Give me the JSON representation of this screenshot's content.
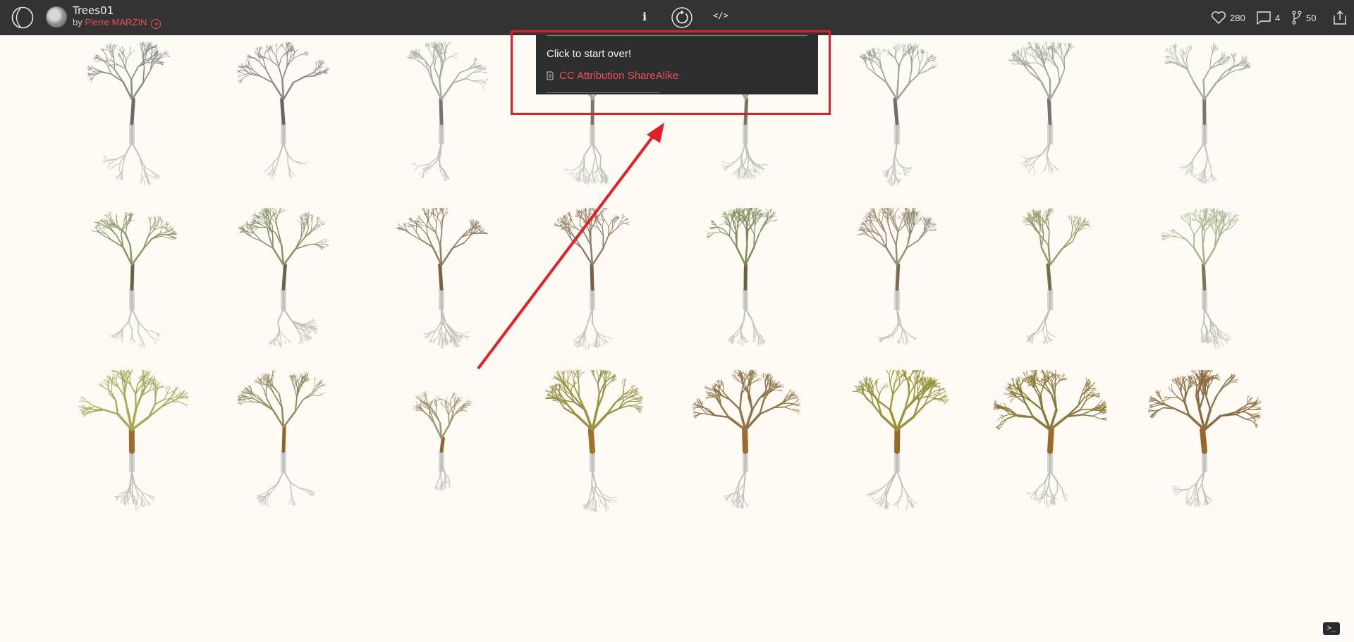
{
  "header": {
    "title": "Trees01",
    "by_prefix": "by",
    "author": "Pierre MARZIN",
    "follow_glyph": "+",
    "info_glyph": "i",
    "code_glyph": "</>",
    "stats": {
      "likes": "280",
      "comments": "4",
      "forks": "50"
    }
  },
  "popup": {
    "message": "Click to start over!",
    "license": "CC Attribution ShareAlike"
  },
  "console_glyph": "≻_",
  "colors": {
    "topbar": "#333333",
    "accent": "#e8535b",
    "canvas_bg": "#fdfbf4",
    "annotation": "#e0202a"
  },
  "icons": [
    "logo-icon",
    "avatar",
    "info-icon",
    "restart-icon",
    "code-icon",
    "heart-icon",
    "comment-icon",
    "fork-icon",
    "share-icon",
    "document-icon",
    "console-icon"
  ],
  "trees": [
    {
      "canopy": "#8a8a86",
      "trunk": "#6e6a63",
      "style": "bare"
    },
    {
      "canopy": "#8a8780",
      "trunk": "#6a655d",
      "style": "bare"
    },
    {
      "canopy": "#a8aca0",
      "trunk": "#77756d",
      "style": "bare"
    },
    {
      "canopy": "#a7a89a",
      "trunk": "#7a766a",
      "style": "bare"
    },
    {
      "canopy": "#a8a593",
      "trunk": "#7b7465",
      "style": "bare"
    },
    {
      "canopy": "#9ca099",
      "trunk": "#6f6d66",
      "style": "bare"
    },
    {
      "canopy": "#a3a69b",
      "trunk": "#75736a",
      "style": "bare"
    },
    {
      "canopy": "#a6ab9c",
      "trunk": "#7a786e",
      "style": "low"
    },
    {
      "canopy": "#8b9467",
      "trunk": "#6b6149",
      "style": "leafy"
    },
    {
      "canopy": "#8a906c",
      "trunk": "#6d634c",
      "style": "leafy"
    },
    {
      "canopy": "#8d7c60",
      "trunk": "#7a6245",
      "style": "leafy"
    },
    {
      "canopy": "#8f7c66",
      "trunk": "#76604a",
      "style": "low"
    },
    {
      "canopy": "#7e8a5a",
      "trunk": "#6c5f42",
      "style": "leafy"
    },
    {
      "canopy": "#978c72",
      "trunk": "#7e6a4c",
      "style": "leafy"
    },
    {
      "canopy": "#98996f",
      "trunk": "#786c4c",
      "style": "leafy"
    },
    {
      "canopy": "#a7b28f",
      "trunk": "#7e7456",
      "style": "leafy"
    },
    {
      "canopy": "#a6ab5c",
      "trunk": "#9a6b2a",
      "style": "full"
    },
    {
      "canopy": "#8e8a60",
      "trunk": "#8c6530",
      "style": "bare"
    },
    {
      "canopy": "#a39474",
      "trunk": "#8e6530",
      "style": "small"
    },
    {
      "canopy": "#9a9148",
      "trunk": "#a0712c",
      "style": "full"
    },
    {
      "canopy": "#8e7448",
      "trunk": "#9a6c2e",
      "style": "full"
    },
    {
      "canopy": "#99933e",
      "trunk": "#9a6a2a",
      "style": "full"
    },
    {
      "canopy": "#8b7a3e",
      "trunk": "#9e6a28",
      "style": "full"
    },
    {
      "canopy": "#8f6d44",
      "trunk": "#9a6630",
      "style": "full"
    }
  ]
}
